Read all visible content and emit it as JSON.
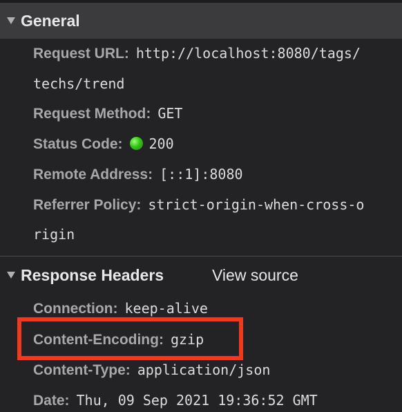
{
  "general": {
    "title": "General",
    "rows": {
      "request_url": {
        "key": "Request URL:",
        "value_line1": "http://localhost:8080/tags/",
        "value_line2": "techs/trend"
      },
      "request_method": {
        "key": "Request Method:",
        "value": "GET"
      },
      "status_code": {
        "key": "Status Code:",
        "value": "200",
        "status_color": "#35c417"
      },
      "remote_address": {
        "key": "Remote Address:",
        "value": "[::1]:8080"
      },
      "referrer_policy": {
        "key": "Referrer Policy:",
        "value_line1": "strict-origin-when-cross-o",
        "value_line2": "rigin"
      }
    }
  },
  "response_headers": {
    "title": "Response Headers",
    "view_source": "View source",
    "rows": {
      "connection": {
        "key": "Connection:",
        "value": "keep-alive"
      },
      "content_encoding": {
        "key": "Content-Encoding:",
        "value": "gzip"
      },
      "content_type": {
        "key": "Content-Type:",
        "value": "application/json"
      },
      "date": {
        "key": "Date:",
        "value": "Thu, 09 Sep 2021 19:36:52 GMT"
      }
    }
  },
  "highlight_color": "#f03a1e"
}
